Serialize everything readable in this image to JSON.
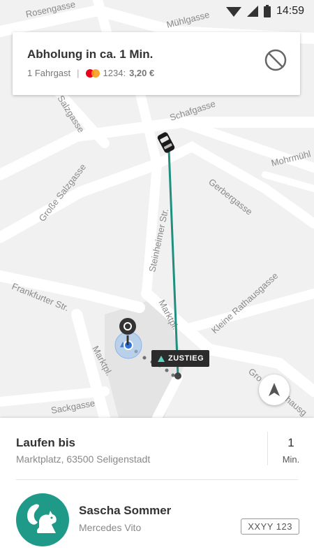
{
  "status_bar": {
    "time": "14:59",
    "icons": [
      "wifi-icon",
      "cell-signal-icon",
      "battery-icon"
    ]
  },
  "pickup": {
    "title": "Abholung in ca. 1 Min.",
    "passengers": "1 Fahrgast",
    "separator": "|",
    "card_digits": "1234:",
    "price": "3,20 €",
    "payment_icon": "mastercard-icon",
    "cancel_icon": "cancel-icon"
  },
  "map": {
    "streets": [
      "Rosengasse",
      "Mühlgasse",
      "Salzgasse",
      "Schafgasse",
      "Mohrmühl",
      "Große Salzgasse",
      "Gerbergasse",
      "Steinheimer Str.",
      "Frankfurter Str.",
      "Marktpl.",
      "Kleine Rathausgasse",
      "Marktpl.",
      "Sackgasse",
      "Gro",
      "hausg"
    ],
    "dropoff_label": "ZUSTIEG",
    "route_color": "#1f8f7f",
    "locate_icon": "navigation-arrow-icon"
  },
  "walk": {
    "title": "Laufen bis",
    "address": "Marktplatz, 63500 Seligenstadt",
    "minutes": "1",
    "unit": "Min."
  },
  "driver": {
    "name": "Sascha Sommer",
    "car": "Mercedes Vito",
    "plate": "XXYY 123",
    "avatar_icon": "squirrel-icon",
    "avatar_color": "#1f9a88"
  }
}
